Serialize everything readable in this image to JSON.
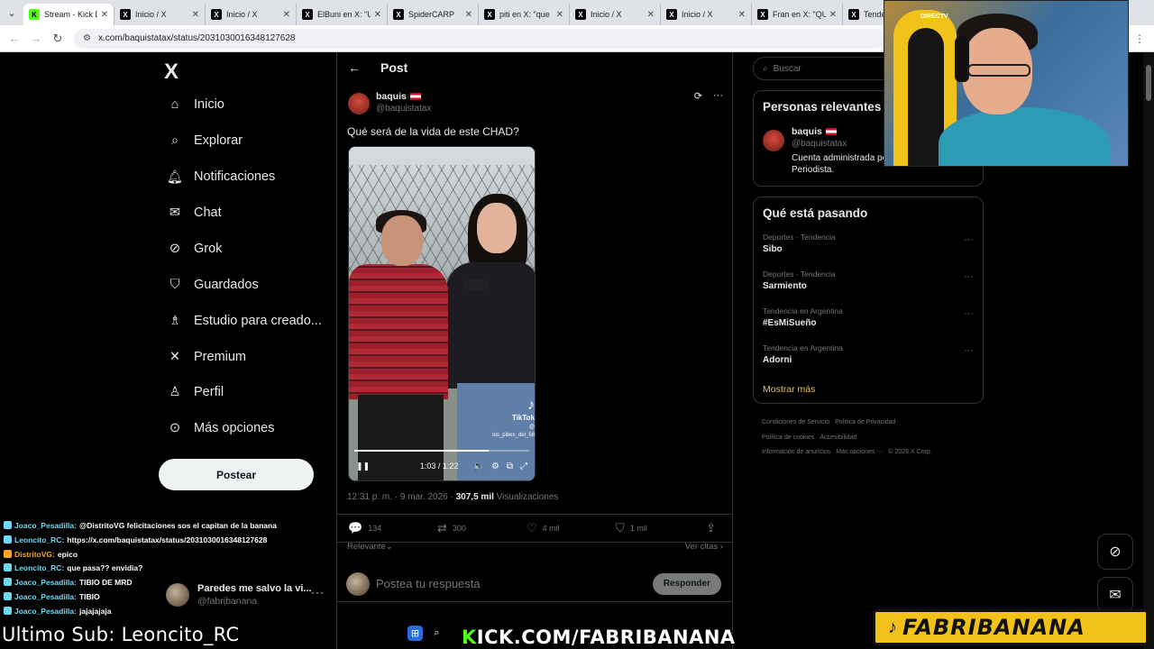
{
  "browser": {
    "tabs": [
      {
        "title": "Stream - Kick D",
        "icon": "kick"
      },
      {
        "title": "Inicio / X",
        "icon": "x"
      },
      {
        "title": "Inicio / X",
        "icon": "x"
      },
      {
        "title": "ElBuni en X: \"U",
        "icon": "x"
      },
      {
        "title": "SpiderCARP",
        "icon": "x"
      },
      {
        "title": "piti en X: \"que",
        "icon": "x"
      },
      {
        "title": "Inicio / X",
        "icon": "x"
      },
      {
        "title": "Inicio / X",
        "icon": "x"
      },
      {
        "title": "Fran en X: \"QU",
        "icon": "x"
      },
      {
        "title": "Tenden",
        "icon": "x"
      }
    ],
    "url": "x.com/baquistatax/status/2031030016348127628"
  },
  "sidebar": {
    "logo": "X",
    "items": [
      {
        "label": "Inicio",
        "icon": "home-icon"
      },
      {
        "label": "Explorar",
        "icon": "search-icon"
      },
      {
        "label": "Notificaciones",
        "icon": "bell-icon"
      },
      {
        "label": "Chat",
        "icon": "mail-icon"
      },
      {
        "label": "Grok",
        "icon": "grok-icon"
      },
      {
        "label": "Guardados",
        "icon": "bookmark-icon"
      },
      {
        "label": "Estudio para creado...",
        "icon": "creator-studio-icon"
      },
      {
        "label": "Premium",
        "icon": "x-premium-icon"
      },
      {
        "label": "Perfil",
        "icon": "person-icon"
      },
      {
        "label": "Más opciones",
        "icon": "more-circle-icon"
      }
    ],
    "post_button": "Postear",
    "account": {
      "name": "Paredes me salvo la vi...",
      "handle": "@fabribanana"
    }
  },
  "post": {
    "header": "Post",
    "author_name": "baquis",
    "author_handle": "@baquistatax",
    "text": "Qué será de la vida de este CHAD?",
    "video": {
      "time": "1:03 / 1:22",
      "progress": 0.77,
      "tiktok_label": "TikTok",
      "tiktok_user": "@ los_pibes_del_58"
    },
    "timestamp": "12:31 p. m. · 9 mar. 2026 ·",
    "views_count": "307,5 mil",
    "views_label": "Visualizaciones",
    "stats": {
      "replies": "134",
      "reposts": "300",
      "likes": "4 mil",
      "bookmarks": "1 mil"
    },
    "sort_label": "Relevante",
    "quotes_label": "Ver citas",
    "reply_placeholder": "Postea tu respuesta",
    "reply_button": "Responder"
  },
  "right": {
    "search_placeholder": "Buscar",
    "relevant_title": "Personas relevantes",
    "relevant_name": "baquis",
    "relevant_handle": "@baquistatax",
    "relevant_bio": "Cuenta administrada po",
    "relevant_bio2": "Periodista.",
    "trending_title": "Qué está pasando",
    "trends": [
      {
        "category": "Deportes · Tendencia",
        "name": "Sibo"
      },
      {
        "category": "Deportes · Tendencia",
        "name": "Sarmiento"
      },
      {
        "category": "Tendencia en Argentina",
        "name": "#EsMiSueño"
      },
      {
        "category": "Tendencia en Argentina",
        "name": "Adorni"
      }
    ],
    "show_more": "Mostrar más",
    "footer": [
      "Condiciones de Servicio",
      "Política de Privacidad",
      "Política de cookies",
      "Accesibilidad",
      "Información de anuncios",
      "Más opciones ···",
      "© 2026 X Corp."
    ]
  },
  "stream": {
    "chat": [
      {
        "user": "Joaco_Pesadilla:",
        "msg": "@DistritoVG felicitaciones sos el capitan de la banana",
        "color": "#6fd8f5"
      },
      {
        "user": "Leoncito_RC:",
        "msg": "https://x.com/baquistatax/status/2031030016348127628",
        "color": "#6fd8f5"
      },
      {
        "user": "DistritoVG:",
        "msg": "epico",
        "color": "#f5a623"
      },
      {
        "user": "Leoncito_RC:",
        "msg": "que pasa?? envidia?",
        "color": "#6fd8f5"
      },
      {
        "user": "Joaco_Pesadilla:",
        "msg": "TIBIO DE MRD",
        "color": "#6fd8f5"
      },
      {
        "user": "Joaco_Pesadilla:",
        "msg": "TIBIO",
        "color": "#6fd8f5"
      },
      {
        "user": "Joaco_Pesadilla:",
        "msg": "jajajajaja",
        "color": "#6fd8f5"
      }
    ],
    "last_sub": "Ultimo Sub: Leoncito_RC",
    "kick_k": "K",
    "kick_url": "ICK.COM/FABRIBANANA",
    "banner": "FABRIBANANA",
    "webcam_label": "DIRECTV"
  },
  "colors": {
    "accent_yellow": "#f2c21a",
    "kick_green": "#53fc18",
    "background": "#000000",
    "muted": "#71767b"
  }
}
